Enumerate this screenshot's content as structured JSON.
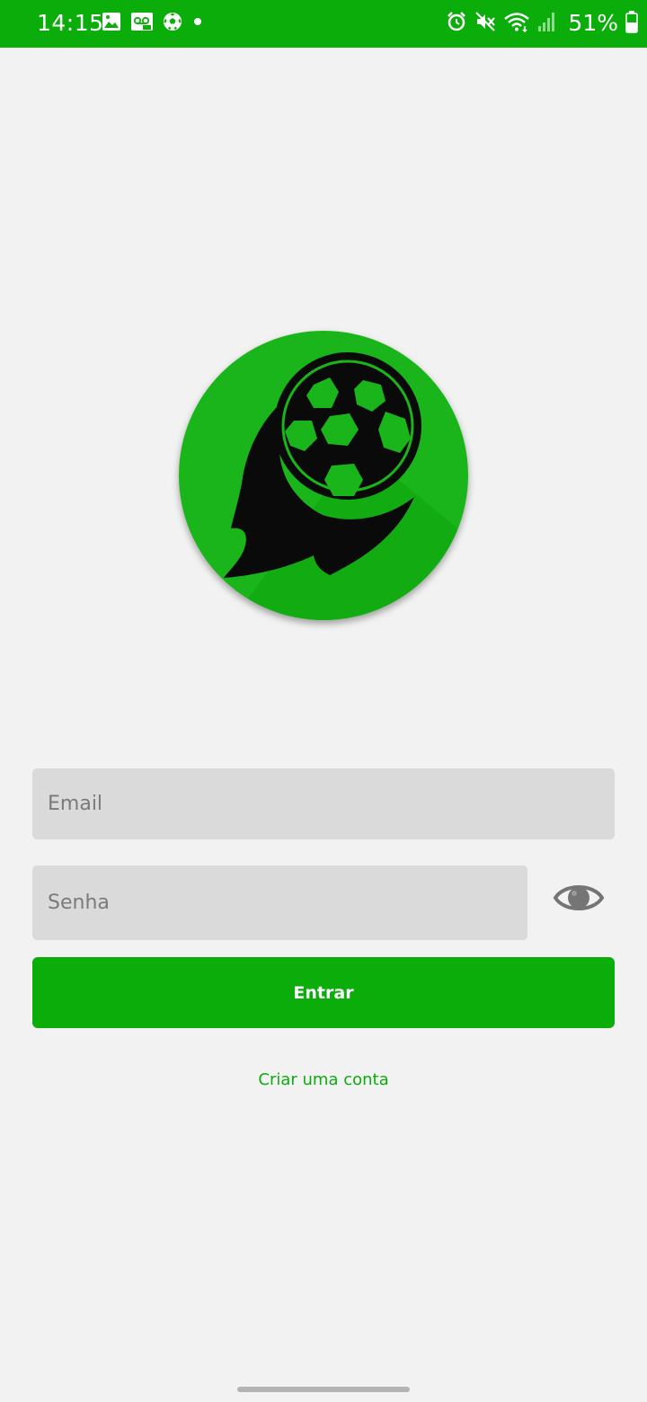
{
  "status_bar": {
    "time": "14:15",
    "battery": "51%",
    "color": "#0bad0b",
    "left_icons": [
      "image-icon",
      "voicemail-icon",
      "soccer-ball-icon",
      "dot-icon"
    ],
    "right_icons": [
      "alarm-icon",
      "mute-icon",
      "wifi-icon",
      "signal-icon",
      "battery-icon"
    ]
  },
  "logo": {
    "icon": "soccer-ball-logo-icon",
    "background_color": "#1ab51a"
  },
  "form": {
    "email_placeholder": "Email",
    "password_placeholder": "Senha",
    "show_password_icon": "eye-icon",
    "login_label": "Entrar",
    "create_account_label": "Criar uma conta",
    "accent_color": "#0bad0b"
  }
}
